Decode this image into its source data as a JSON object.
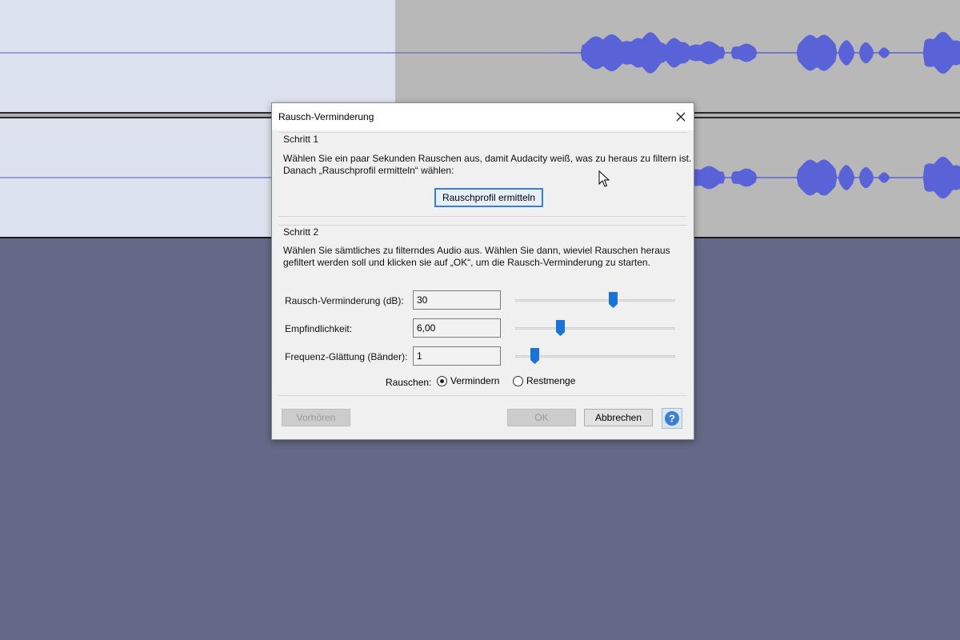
{
  "colors": {
    "waveform": "#5a62d8",
    "selection_bg": "#dde3ee",
    "unselected_bg": "#b8b8b8",
    "workspace_bg": "#636986",
    "focus_border": "#3c7fd0",
    "help_icon": "#3c7fd0"
  },
  "dialog": {
    "title": "Rausch-Verminderung",
    "close_icon": "close-icon",
    "step1": {
      "title": "Schritt 1",
      "line1": "Wählen Sie ein paar Sekunden Rauschen aus, damit Audacity weiß, was zu heraus zu filtern ist.",
      "line2": "Danach „Rauschprofil ermitteln“ wählen:",
      "profile_button": "Rauschprofil ermitteln"
    },
    "step2": {
      "title": "Schritt 2",
      "line1": "Wählen Sie sämtliches zu filterndes Audio aus. Wählen Sie dann, wieviel Rauschen heraus",
      "line2": "gefiltert werden soll und klicken sie auf „OK“, um die Rausch-Verminderung zu starten.",
      "params": [
        {
          "label": "Rausch-Verminderung (dB):",
          "value": "30",
          "slider_fraction": 0.62
        },
        {
          "label": "Empfindlichkeit:",
          "value": "6,00",
          "slider_fraction": 0.27
        },
        {
          "label": "Frequenz-Glättung (Bänder):",
          "value": "1",
          "slider_fraction": 0.1
        }
      ],
      "noise_label": "Rauschen:",
      "options": [
        {
          "label": "Vermindern",
          "selected": true
        },
        {
          "label": "Restmenge",
          "selected": false
        }
      ]
    },
    "buttons": {
      "preview": "Vorhören",
      "ok": "OK",
      "cancel": "Abbrechen",
      "help_icon": "help-icon",
      "help_glyph": "?"
    }
  }
}
